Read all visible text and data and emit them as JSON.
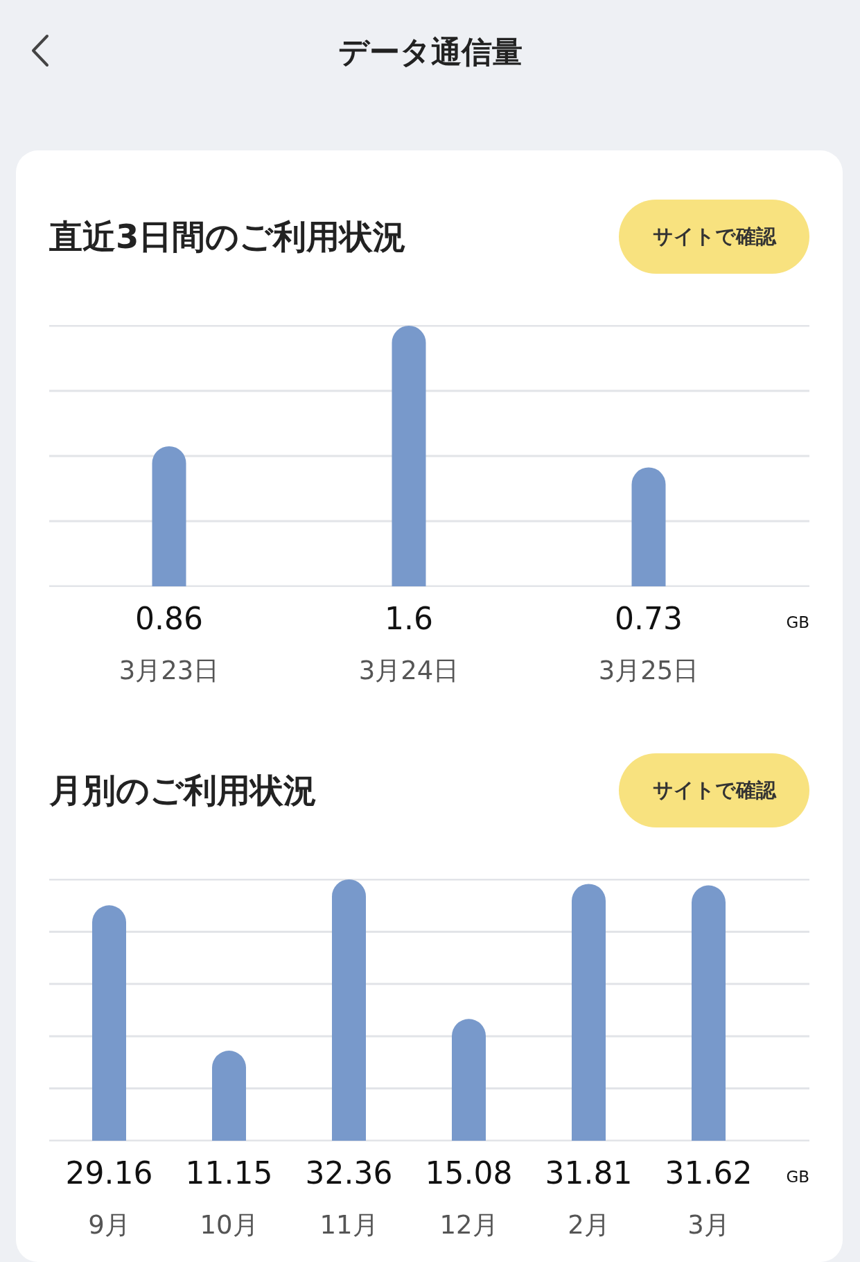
{
  "header": {
    "title": "データ通信量"
  },
  "sections": [
    {
      "title": "直近3日間のご利用状況",
      "button": "サイトで確認",
      "unit": "GB",
      "chart_data": {
        "type": "bar",
        "categories": [
          "3月23日",
          "3月24日",
          "3月25日"
        ],
        "series": [
          {
            "color": "#7899cb",
            "values": [
              0.86,
              1.6,
              0.73
            ]
          }
        ],
        "data_labels": true
      }
    },
    {
      "title": "月別のご利用状況",
      "button": "サイトで確認",
      "unit": "GB",
      "chart_data": {
        "type": "bar",
        "categories": [
          "9月",
          "10月",
          "11月",
          "12月",
          "2月",
          "3月"
        ],
        "series": [
          {
            "color": "#7899cb",
            "values": [
              29.16,
              11.15,
              32.36,
              15.08,
              31.81,
              31.62
            ]
          }
        ],
        "data_labels": true
      }
    }
  ]
}
